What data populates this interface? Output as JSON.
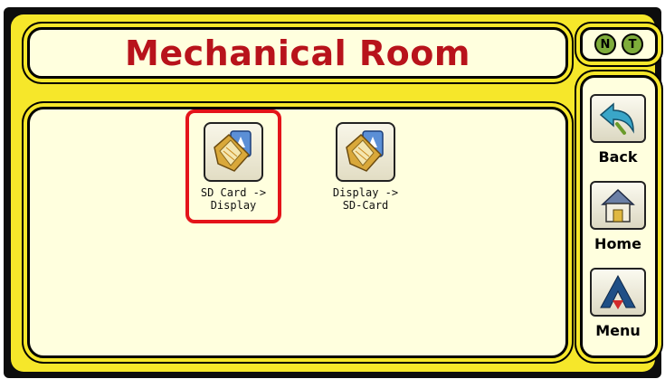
{
  "header": {
    "title": "Mechanical Room"
  },
  "status": {
    "badges": [
      "N",
      "T"
    ]
  },
  "tiles": [
    {
      "label": "SD Card ->\nDisplay",
      "selected": true,
      "icon": "folder-sd-card-icon"
    },
    {
      "label": "Display ->\nSD-Card",
      "selected": false,
      "icon": "folder-sd-card-icon"
    }
  ],
  "sidebar": {
    "items": [
      {
        "label": "Back",
        "icon": "back-arrow-icon"
      },
      {
        "label": "Home",
        "icon": "house-icon"
      },
      {
        "label": "Menu",
        "icon": "menu-logo-icon"
      }
    ]
  },
  "colors": {
    "title": "#b8131b",
    "frame_yellow": "#f6e72a",
    "panel": "#ffffde",
    "selection": "#e4141a",
    "badge": "#7eac3a"
  }
}
